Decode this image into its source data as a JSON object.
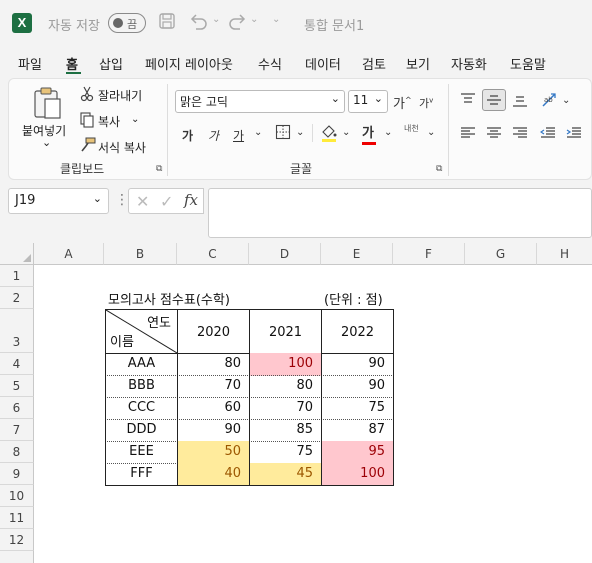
{
  "titlebar": {
    "autosave_label": "자동 저장",
    "autosave_state": "끔",
    "doc_title": "통합 문서1"
  },
  "tabs": [
    "파일",
    "홈",
    "삽입",
    "페이지 레이아웃",
    "수식",
    "데이터",
    "검토",
    "보기",
    "자동화",
    "도움말"
  ],
  "active_tab": "홈",
  "ribbon": {
    "clipboard": {
      "paste": "붙여넣기",
      "cut": "잘라내기",
      "copy": "복사",
      "format_painter": "서식 복사",
      "group": "클립보드"
    },
    "font": {
      "font_name": "맑은 고딕",
      "font_size": "11",
      "grow": "가",
      "shrink": "가",
      "bold": "가",
      "italic": "가",
      "underline": "가",
      "font_color_glyph": "가",
      "phonetic": "내천",
      "group": "글꼴"
    }
  },
  "formula_bar": {
    "name_box": "J19",
    "fx": "fx",
    "value": ""
  },
  "columns": [
    "A",
    "B",
    "C",
    "D",
    "E",
    "F",
    "G",
    "H"
  ],
  "rows": [
    "1",
    "2",
    "3",
    "4",
    "5",
    "6",
    "7",
    "8",
    "9",
    "10",
    "11",
    "12"
  ],
  "sheet": {
    "title": "모의고사 점수표(수학)",
    "unit": "(단위 : 점)",
    "header_year": "연도",
    "header_name": "이름",
    "years": [
      "2020",
      "2021",
      "2022"
    ],
    "records": [
      {
        "name": "AAA",
        "values": [
          "80",
          "100",
          "90"
        ]
      },
      {
        "name": "BBB",
        "values": [
          "70",
          "80",
          "90"
        ]
      },
      {
        "name": "CCC",
        "values": [
          "60",
          "70",
          "75"
        ]
      },
      {
        "name": "DDD",
        "values": [
          "90",
          "85",
          "87"
        ]
      },
      {
        "name": "EEE",
        "values": [
          "50",
          "75",
          "95"
        ]
      },
      {
        "name": "FFF",
        "values": [
          "40",
          "45",
          "100"
        ]
      }
    ]
  },
  "colors": {
    "excel_green": "#1d6f42",
    "highlight_red_fill": "#ffc7ce",
    "highlight_red_text": "#9c0006",
    "highlight_yellow_fill": "#ffeb9c",
    "highlight_yellow_text": "#9c5700"
  }
}
